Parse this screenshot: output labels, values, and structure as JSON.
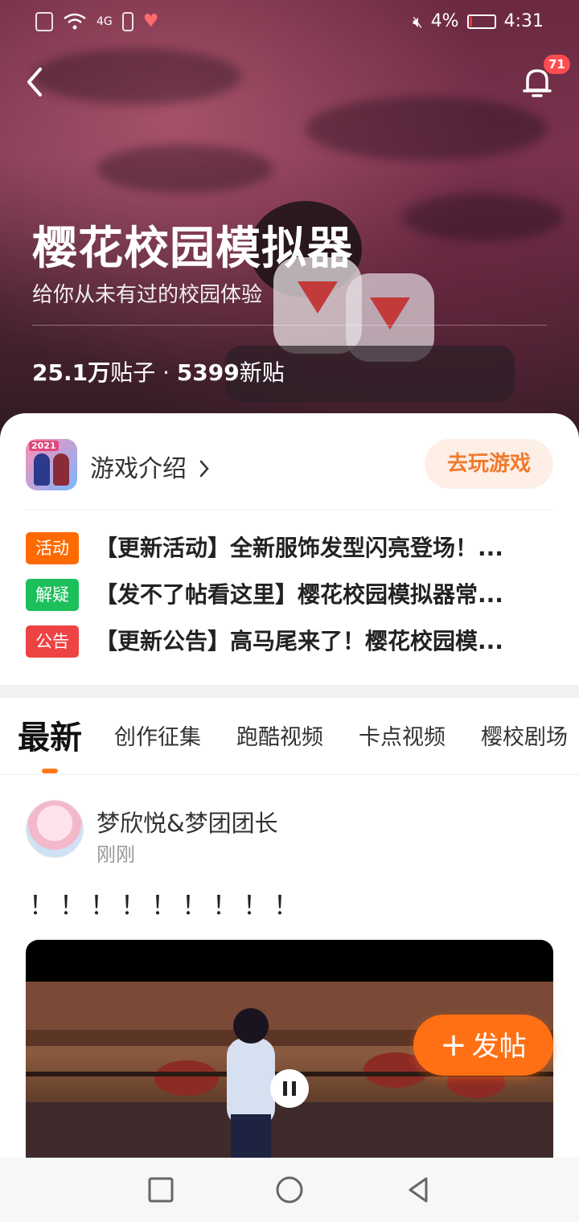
{
  "status_bar": {
    "network": "4G",
    "battery": "4%",
    "time": "4:31",
    "colors": {
      "battery_low": "#e53935"
    }
  },
  "header": {
    "notification_count": "71",
    "title": "樱花校园模拟器",
    "subtitle": "给你从未有过的校园体验",
    "stats": {
      "posts_count": "25.1万",
      "posts_label": "贴子",
      "separator": " · ",
      "new_count": "5399",
      "new_label": "新贴"
    }
  },
  "game_card": {
    "icon_label": "2021",
    "intro_label": "游戏介绍",
    "play_label": "去玩游戏",
    "notices": [
      {
        "tag": "活动",
        "tag_color": "#ff6a00",
        "text": "【更新活动】全新服饰发型闪亮登场！..."
      },
      {
        "tag": "解疑",
        "tag_color": "#1cc05a",
        "text": "【发不了帖看这里】樱花校园模拟器常..."
      },
      {
        "tag": "公告",
        "tag_color": "#ee4343",
        "text": "【更新公告】高马尾来了！樱花校园模..."
      }
    ]
  },
  "tabs": [
    {
      "label": "最新",
      "active": true
    },
    {
      "label": "创作征集",
      "active": false
    },
    {
      "label": "跑酷视频",
      "active": false
    },
    {
      "label": "卡点视频",
      "active": false
    },
    {
      "label": "樱校剧场",
      "active": false
    }
  ],
  "post": {
    "author": "梦欣悦&梦团团长",
    "time": "刚刚",
    "text": "！！！！！！！！！"
  },
  "fab": {
    "plus": "+",
    "label": "发帖"
  },
  "accent_color": "#ff7014"
}
